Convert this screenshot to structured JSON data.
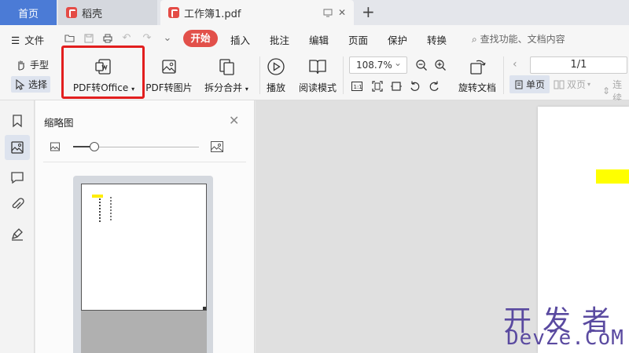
{
  "tabs": {
    "home": "首页",
    "daoke": "稻壳",
    "document": "工作簿1.pdf"
  },
  "menu": {
    "file": "文件",
    "items": [
      "开始",
      "插入",
      "批注",
      "编辑",
      "页面",
      "保护",
      "转换"
    ],
    "search_placeholder": "查找功能、文档内容"
  },
  "toolbar": {
    "hand": "手型",
    "select": "选择",
    "pdf_to_office": "PDF转Office",
    "pdf_to_image": "PDF转图片",
    "split_merge": "拆分合并",
    "play": "播放",
    "read_mode": "阅读模式",
    "zoom": "108.7%",
    "rotate_doc": "旋转文档",
    "page_indicator": "1/1",
    "single_page": "单页",
    "double_page": "双页",
    "continuous": "连续"
  },
  "thumbnail_panel": {
    "title": "缩略图",
    "size_slider_fraction": 0.17
  },
  "watermark": {
    "cn": "开发者",
    "en": "DevZe.CoM"
  },
  "colors": {
    "accent_blue": "#4b7bd6",
    "start_tab_red": "#e2504a",
    "highlight_box_red": "#e21e1e",
    "doc_highlight_yellow": "#ffff00"
  }
}
